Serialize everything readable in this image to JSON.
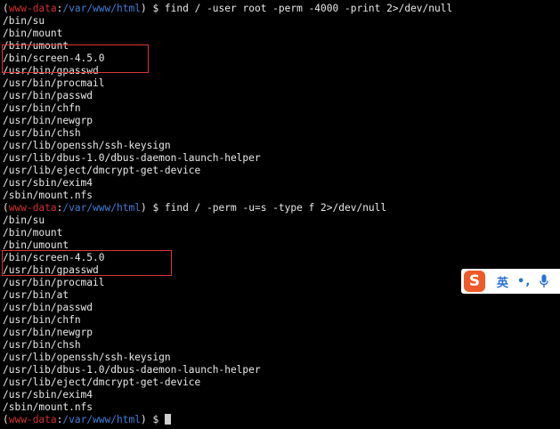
{
  "prompt": {
    "open": "(",
    "user": "www-data",
    "sep": ":",
    "path": "/var/www/html",
    "close": ")",
    "symbol": " $ "
  },
  "commands": [
    {
      "command": "find / -user root -perm -4000 -print 2>/dev/null",
      "output": [
        "/bin/su",
        "/bin/mount",
        "/bin/umount",
        "/bin/screen-4.5.0",
        "/usr/bin/gpasswd",
        "/usr/bin/procmail",
        "/usr/bin/passwd",
        "/usr/bin/chfn",
        "/usr/bin/newgrp",
        "/usr/bin/chsh",
        "/usr/lib/openssh/ssh-keysign",
        "/usr/lib/dbus-1.0/dbus-daemon-launch-helper",
        "/usr/lib/eject/dmcrypt-get-device",
        "/usr/sbin/exim4",
        "/sbin/mount.nfs"
      ]
    },
    {
      "command": "find / -perm -u=s -type f 2>/dev/null",
      "output": [
        "/bin/su",
        "/bin/mount",
        "/bin/umount",
        "/bin/screen-4.5.0",
        "/usr/bin/gpasswd",
        "/usr/bin/procmail",
        "/usr/bin/at",
        "/usr/bin/passwd",
        "/usr/bin/chfn",
        "/usr/bin/newgrp",
        "/usr/bin/chsh",
        "/usr/lib/openssh/ssh-keysign",
        "/usr/lib/dbus-1.0/dbus-daemon-launch-helper",
        "/usr/lib/eject/dmcrypt-get-device",
        "/usr/sbin/exim4",
        "/sbin/mount.nfs"
      ]
    }
  ],
  "ime_toolbar": {
    "logo": "S",
    "language": "英",
    "punctuation": "•,",
    "mic_icon": "microphone-icon",
    "logo_color": "#ef5a2a"
  },
  "colors": {
    "background": "#000000",
    "text": "#e8e8e8",
    "prompt_user": "#d22f2f",
    "prompt_path": "#3c7fd6",
    "highlight_box": "#d83636"
  }
}
